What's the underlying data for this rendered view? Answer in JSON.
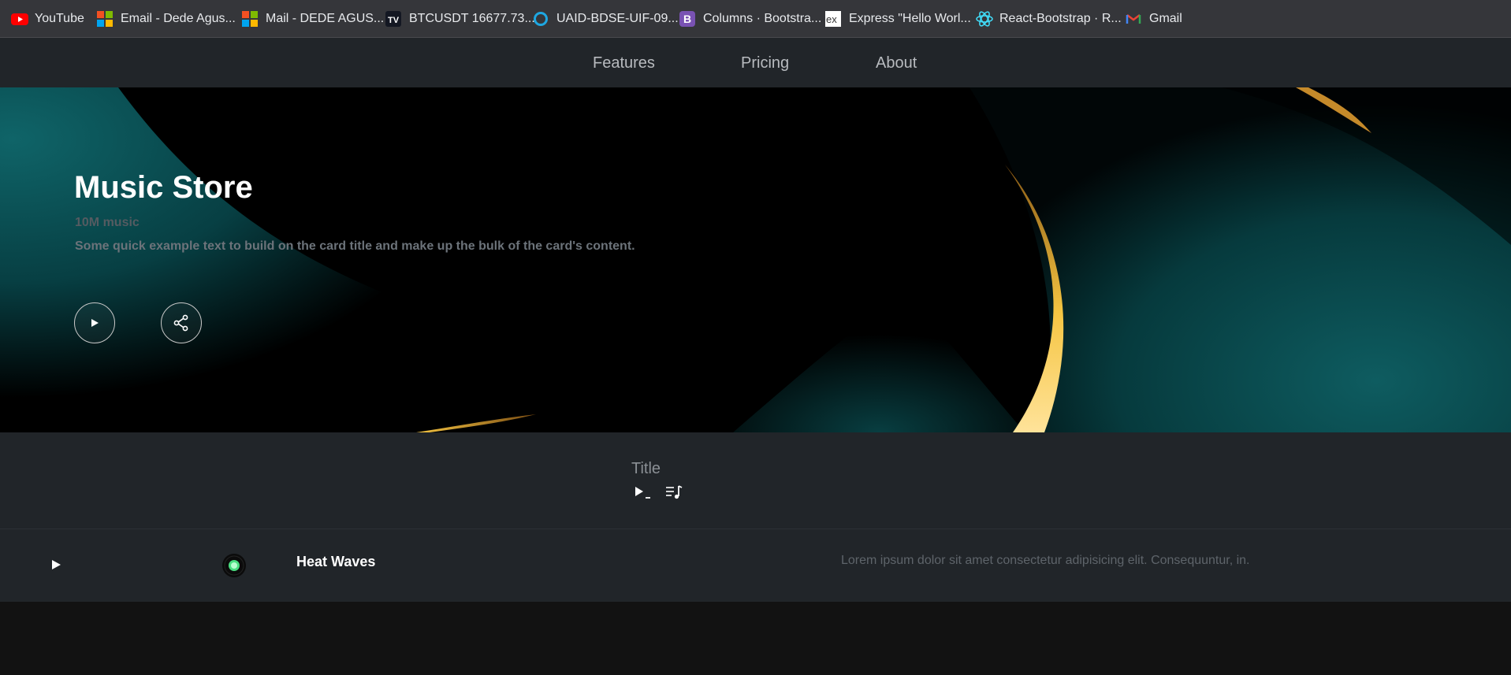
{
  "bookmarks": [
    {
      "label": "YouTube",
      "icon": "youtube-icon"
    },
    {
      "label": "Email - Dede Agus...",
      "icon": "microsoft-icon"
    },
    {
      "label": "Mail - DEDE AGUS...",
      "icon": "microsoft-icon"
    },
    {
      "label": "BTCUSDT 16677.73...",
      "icon": "tradingview-icon"
    },
    {
      "label": "UAID-BDSE-UIF-09...",
      "icon": "circle-icon"
    },
    {
      "label": "Columns · Bootstra...",
      "icon": "bootstrap-icon"
    },
    {
      "label": "Express \"Hello Worl...",
      "icon": "express-icon"
    },
    {
      "label": "React-Bootstrap · R...",
      "icon": "react-bootstrap-icon"
    },
    {
      "label": "Gmail",
      "icon": "gmail-icon"
    }
  ],
  "nav": {
    "features": "Features",
    "pricing": "Pricing",
    "about": "About"
  },
  "hero": {
    "title": "Music Store",
    "subtitle": "10M music",
    "text": "Some quick example text to build on the card title and make up the bulk of the card's content.",
    "play_icon": "play-icon",
    "share_icon": "share-icon"
  },
  "section": {
    "title": "Title",
    "play_next_icon": "play-next-icon",
    "playlist_icon": "playlist-icon"
  },
  "tracks": [
    {
      "name": "Heat Waves",
      "description": "Lorem ipsum dolor sit amet consectetur adipisicing elit. Consequuntur, in."
    }
  ],
  "colors": {
    "accent_teal": "#0f5f63",
    "accent_gold": "#f5c542",
    "nav_bg": "#212529",
    "record_green": "#4ade80"
  }
}
